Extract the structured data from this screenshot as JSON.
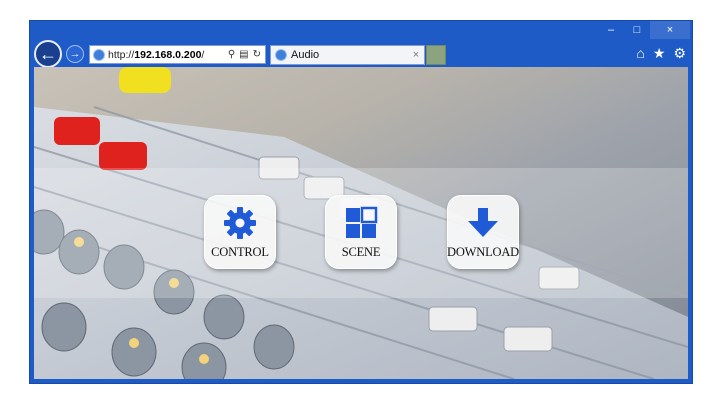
{
  "browser": {
    "address_bar": {
      "url_prefix": "http://",
      "url_host": "192.168.0.200",
      "url_suffix": "/",
      "search_icon": "search-icon",
      "compat_icon": "compatibility-view-icon",
      "refresh_icon": "refresh-icon"
    },
    "tab": {
      "title": "Audio",
      "close_label": "×"
    },
    "window_controls": {
      "minimize": "–",
      "maximize": "□",
      "close": "×"
    },
    "toolbar_icons": [
      "home-icon",
      "favorites-star-icon",
      "settings-gear-icon"
    ]
  },
  "colors": {
    "frame": "#1e5bc6",
    "accent": "#1f5bd6",
    "button_bg": "#f8f8f8"
  },
  "app": {
    "buttons": [
      {
        "label": "CONTROL",
        "icon": "gear-icon"
      },
      {
        "label": "SCENE",
        "icon": "scene-grid-icon"
      },
      {
        "label": "DOWNLOAD",
        "icon": "download-arrow-icon"
      }
    ]
  }
}
